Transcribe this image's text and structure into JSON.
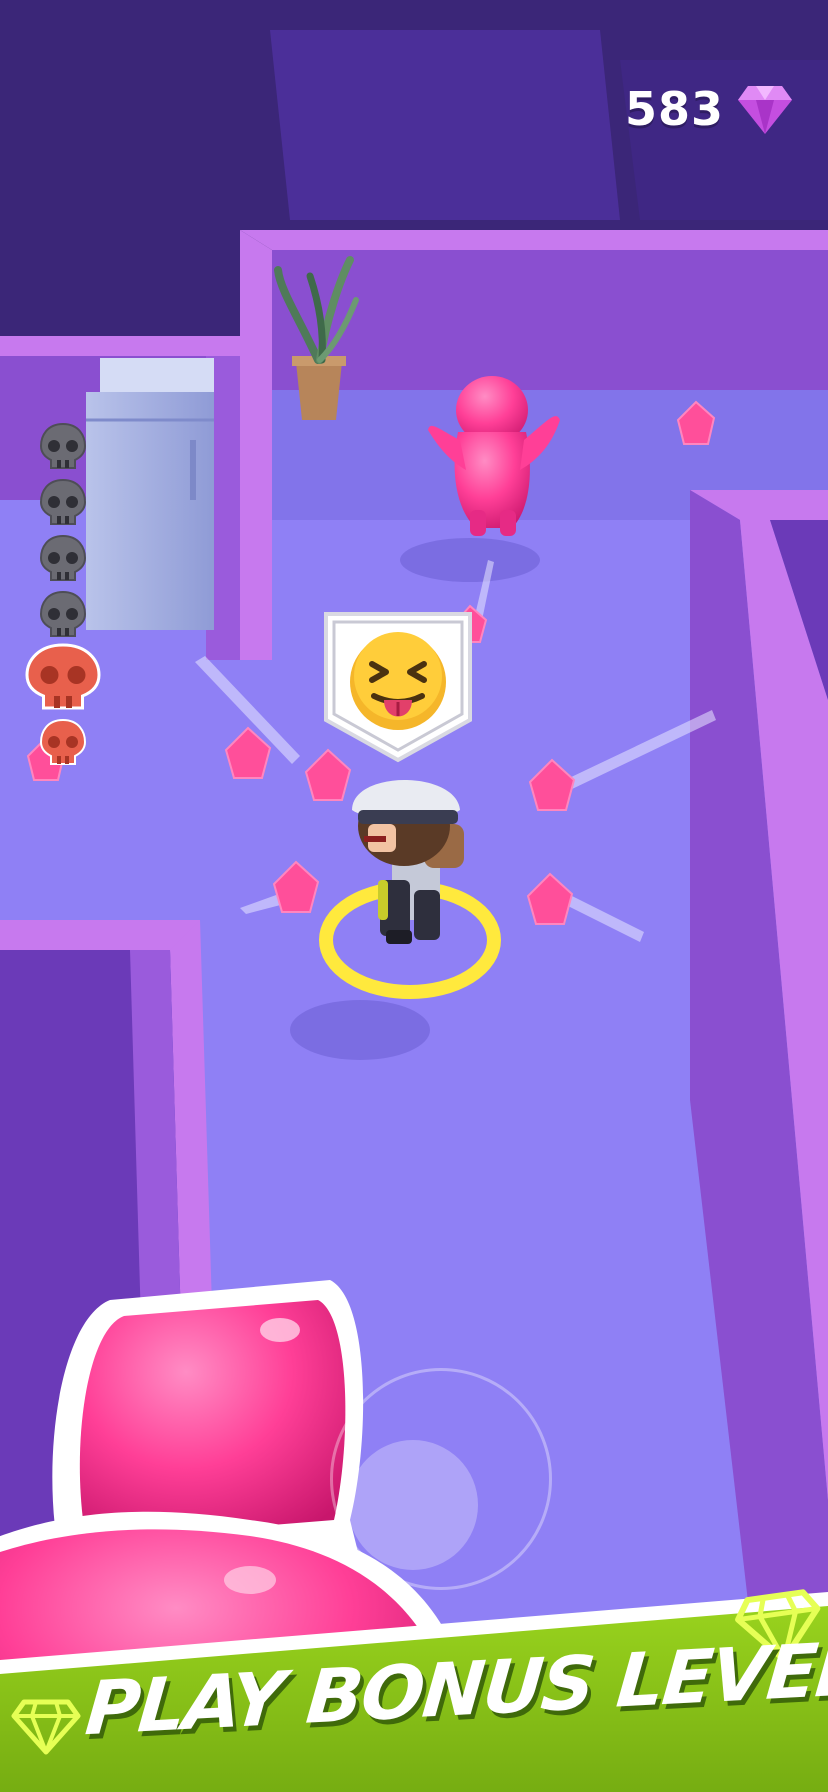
{
  "hud": {
    "gem_count": "583",
    "gem_icon": "diamond-icon",
    "gem_color": "#c44ee0"
  },
  "skulls": {
    "dead_count": 4,
    "alive_count": 2,
    "dead_color": "#6b6b73",
    "alive_color": "#e8604c"
  },
  "emote": {
    "icon": "tongue-out-squint-emoji-icon"
  },
  "banner": {
    "text": "PLAY BONUS LEVELS!",
    "color": "#8bc31a",
    "icon": "diamond-outline-icon"
  },
  "colors": {
    "floor": "#8f7ff5",
    "wall_top": "#c779ee",
    "wall_side": "#8a4fd0",
    "enemy": "#ff4fa0",
    "crystal": "#ff4f9a",
    "ring": "#ffe93d"
  }
}
